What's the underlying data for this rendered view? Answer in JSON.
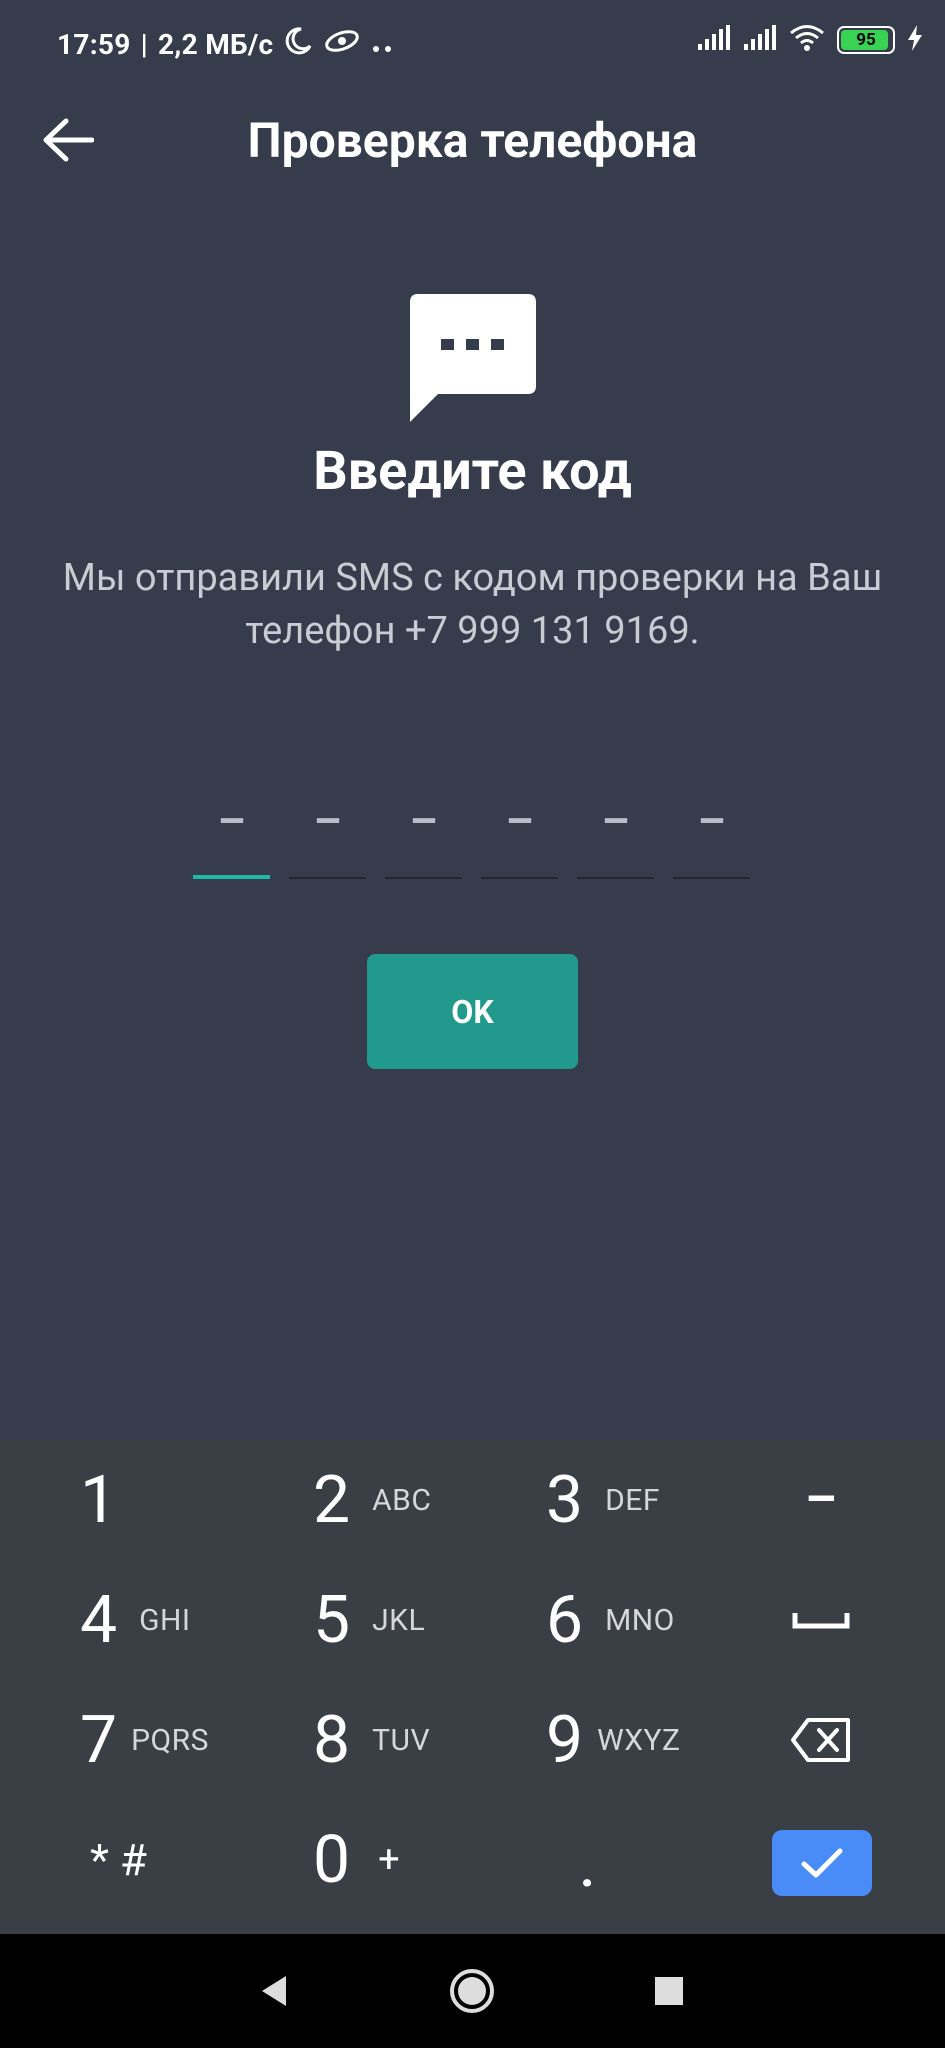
{
  "status_bar": {
    "time": "17:59",
    "network_speed": "2,2 МБ/с",
    "battery_percent": "95",
    "battery_fill": 0.95,
    "icons": [
      "moon-icon",
      "app-notification-icon",
      "more-dots-icon",
      "signal-icon",
      "signal-icon",
      "wifi-icon",
      "battery-icon",
      "charging-icon"
    ]
  },
  "app_bar": {
    "title": "Проверка телефона",
    "back_icon": "arrow-left-icon"
  },
  "content": {
    "icon": "sms-chat-icon",
    "heading": "Введите код",
    "description": "Мы отправили SMS с кодом проверки на Ваш телефон +7 999 131 9169.",
    "code_placeholders": [
      "–",
      "–",
      "–",
      "–",
      "–",
      "–"
    ],
    "ok_label": "OK"
  },
  "keyboard": {
    "keys": [
      {
        "digit": "1",
        "letters": ""
      },
      {
        "digit": "2",
        "letters": "ABC"
      },
      {
        "digit": "3",
        "letters": "DEF"
      },
      {
        "digit": "4",
        "letters": "GHI"
      },
      {
        "digit": "5",
        "letters": "JKL"
      },
      {
        "digit": "6",
        "letters": "MNO"
      },
      {
        "digit": "7",
        "letters": "PQRS"
      },
      {
        "digit": "8",
        "letters": "TUV"
      },
      {
        "digit": "9",
        "letters": "WXYZ"
      },
      {
        "digit": "* #",
        "letters": ""
      },
      {
        "digit": "0",
        "letters": "+"
      },
      {
        "digit": ".",
        "letters": ""
      }
    ],
    "minus_label": "–",
    "accent_color": "#4a8cf7"
  },
  "nav_bar": {
    "buttons": [
      "back-triangle-icon",
      "home-circle-icon",
      "recents-square-icon"
    ]
  },
  "colors": {
    "background": "#363c4c",
    "keyboard_bg": "#3a3f45",
    "primary": "#219a8d",
    "code_active": "#1fb8a8"
  }
}
